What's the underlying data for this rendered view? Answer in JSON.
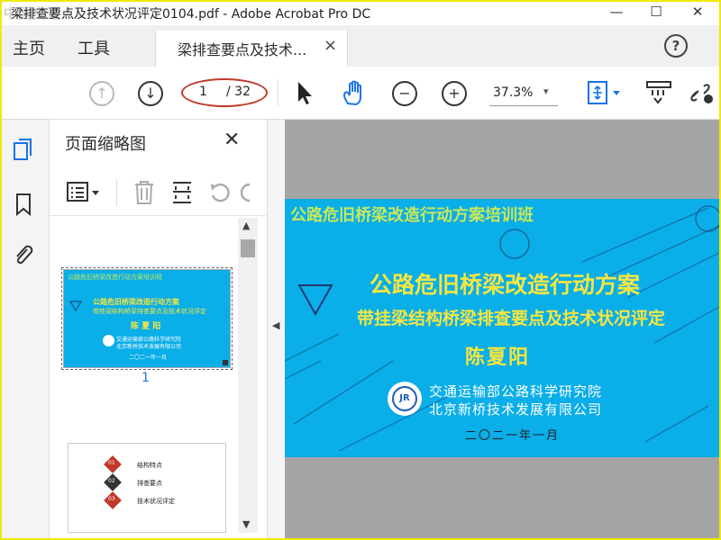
{
  "window": {
    "title": "梁排查要点及技术状况评定0104.pdf - Adobe Acrobat Pro DC",
    "watermark": "中国交通人",
    "minimize": "—",
    "maximize": "☐",
    "close": "✕"
  },
  "menu": {
    "home": "主页",
    "tools": "工具",
    "doc_tab": "梁排查要点及技术...",
    "doc_tab_close": "×",
    "help": "?"
  },
  "toolbar": {
    "prev_page": "↑",
    "next_page": "↓",
    "current_page": "1",
    "total_pages": "/ 32",
    "zoom": "37.3%",
    "zoom_dropdown": "▾"
  },
  "panel": {
    "title": "页面缩略图",
    "close": "✕",
    "page1_number": "1"
  },
  "thumbnail1": {
    "banner": "公路危旧桥梁改造行动方案培训班",
    "title": "公路危旧桥梁改造行动方案",
    "subtitle": "带挂梁结构桥梁排查要点及技术状况评定",
    "author": "陈 夏 阳",
    "org1": "交通运输部公路科学研究院",
    "org2": "北京新桥技术发展有限公司",
    "date": "二〇二一年一月"
  },
  "thumbnail2": {
    "items": [
      {
        "num": "01",
        "label": "结构特点"
      },
      {
        "num": "02",
        "label": "排查要点"
      },
      {
        "num": "03",
        "label": "技术状况评定"
      }
    ]
  },
  "slide": {
    "banner": "公路危旧桥梁改造行动方案培训班",
    "title": "公路危旧桥梁改造行动方案",
    "subtitle": "带挂梁结构桥梁排查要点及技术状况评定",
    "author": "陈夏阳",
    "org1": "交通运输部公路科学研究院",
    "org2": "北京新桥技术发展有限公司",
    "date": "二〇二一年一月"
  },
  "colors": {
    "slide_bg": "#0aaee8",
    "title_yellow": "#f5e640",
    "banner_green": "#c8e85a",
    "highlight_oval": "#c0392b",
    "hand_tool_blue": "#1a73e8"
  }
}
